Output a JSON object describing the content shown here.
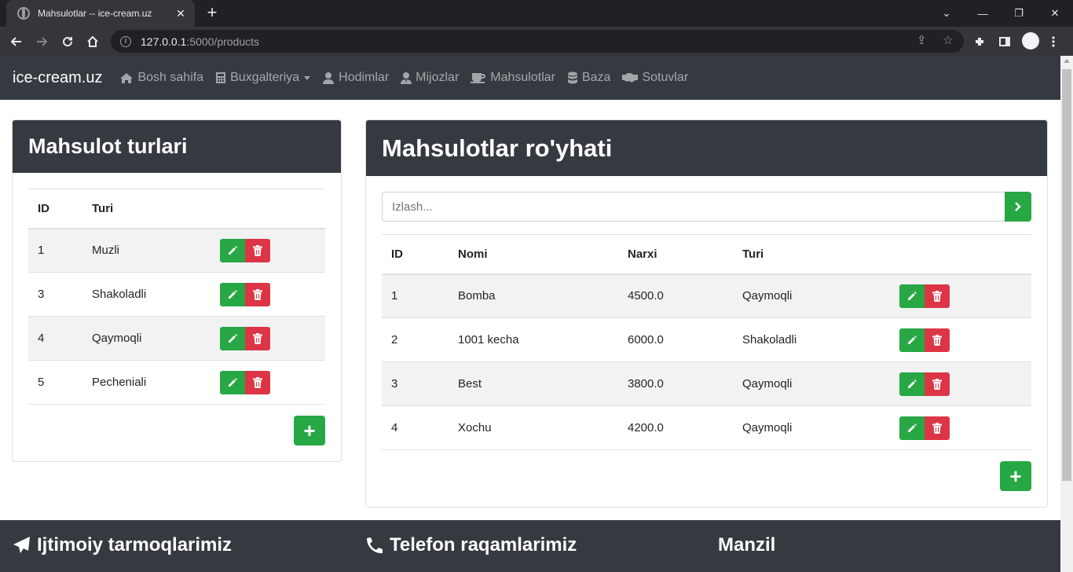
{
  "browser": {
    "tab_title": "Mahsulotlar -- ice-cream.uz",
    "tab_close": "✕",
    "new_tab": "+",
    "url_host": "127.0.0.1",
    "url_path": ":5000/products",
    "window_controls": [
      "⌄",
      "—",
      "❐",
      "✕"
    ]
  },
  "navbar": {
    "brand": "ice-cream.uz",
    "items": [
      {
        "label": "Bosh sahifa",
        "icon": "home-icon"
      },
      {
        "label": "Buxgalteriya",
        "icon": "calculator-icon",
        "dropdown": true
      },
      {
        "label": "Hodimlar",
        "icon": "user-icon"
      },
      {
        "label": "Mijozlar",
        "icon": "user-tie-icon"
      },
      {
        "label": "Mahsulotlar",
        "icon": "mug-icon"
      },
      {
        "label": "Baza",
        "icon": "database-icon"
      },
      {
        "label": "Sotuvlar",
        "icon": "handshake-icon"
      }
    ]
  },
  "types_card": {
    "title": "Mahsulot turlari",
    "headers": [
      "ID",
      "Turi"
    ],
    "rows": [
      {
        "id": "1",
        "name": "Muzli"
      },
      {
        "id": "3",
        "name": "Shakoladli"
      },
      {
        "id": "4",
        "name": "Qaymoqli"
      },
      {
        "id": "5",
        "name": "Pecheniali"
      }
    ],
    "add_label": "+"
  },
  "products_card": {
    "title": "Mahsulotlar ro'yhati",
    "search_placeholder": "Izlash...",
    "search_icon": "chevron-right-icon",
    "headers": [
      "ID",
      "Nomi",
      "Narxi",
      "Turi"
    ],
    "rows": [
      {
        "id": "1",
        "name": "Bomba",
        "price": "4500.0",
        "type": "Qaymoqli"
      },
      {
        "id": "2",
        "name": "1001 kecha",
        "price": "6000.0",
        "type": "Shakoladli"
      },
      {
        "id": "3",
        "name": "Best",
        "price": "3800.0",
        "type": "Qaymoqli"
      },
      {
        "id": "4",
        "name": "Xochu",
        "price": "4200.0",
        "type": "Qaymoqli"
      }
    ],
    "add_label": "+"
  },
  "footer": {
    "social": "Ijtimoiy tarmoqlarimiz",
    "phone": "Telefon raqamlarimiz",
    "address": "Manzil"
  },
  "colors": {
    "dark": "#343a40",
    "success": "#28a745",
    "danger": "#dc3545"
  }
}
